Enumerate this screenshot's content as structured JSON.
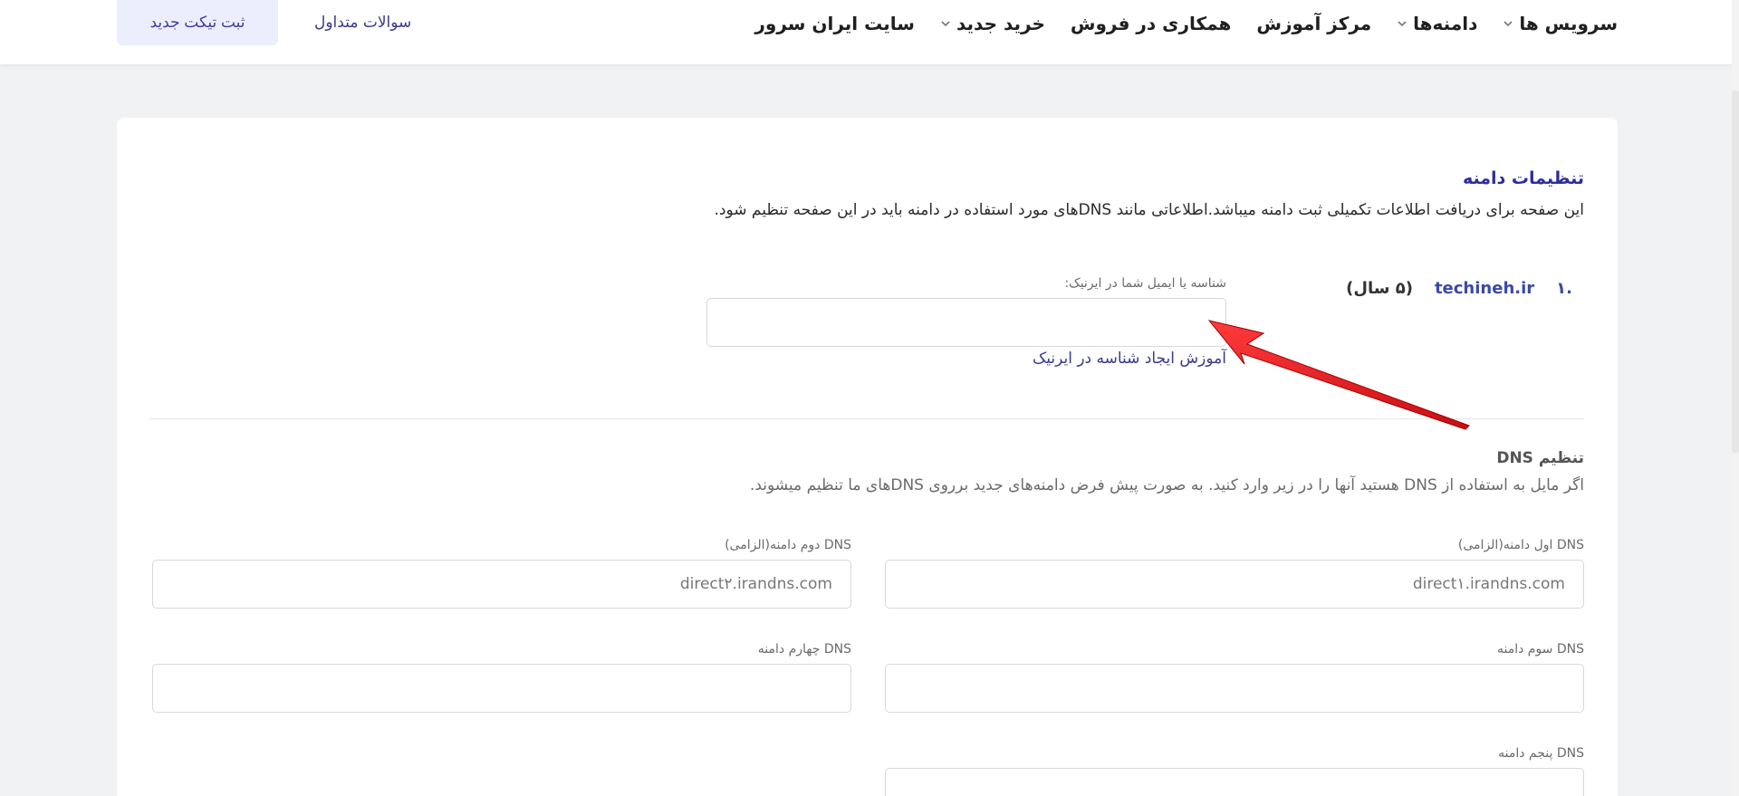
{
  "nav": {
    "items": [
      {
        "label": "سرویس ها",
        "has_dropdown": true
      },
      {
        "label": "دامنه‌ها",
        "has_dropdown": true
      },
      {
        "label": "مرکز آموزش",
        "has_dropdown": false
      },
      {
        "label": "همکاری در فروش",
        "has_dropdown": false
      },
      {
        "label": "خرید جدید",
        "has_dropdown": true
      },
      {
        "label": "سایت ایران سرور",
        "has_dropdown": false
      }
    ],
    "faq_label": "سوالات متداول",
    "new_ticket_label": "ثبت تیکت جدید"
  },
  "settings": {
    "title": "تنظیمات دامنه",
    "description": "این صفحه برای دریافت اطلاعات تکمیلی ثبت دامنه میباشد.اطلاعاتی مانند DNSهای مورد استفاده در دامنه باید در این صفحه تنظیم شود."
  },
  "domain": {
    "index": ".۱",
    "name": "techineh.ir",
    "years": "(۵ سال)",
    "nic_label": "شناسه یا ایمیل شما در ایرنیک:",
    "nic_value": "",
    "nic_help": "آموزش ایجاد شناسه در ایرنیک"
  },
  "dns": {
    "title": "تنظیم DNS",
    "description": "اگر مایل به استفاده از DNS هستید آنها را در زیر وارد کنید. به صورت پیش فرض دامنه‌های جدید برروی DNSهای ما تنظیم میشوند.",
    "fields": [
      {
        "label": "DNS اول دامنه(الزامی)",
        "value": "direct۱.irandns.com"
      },
      {
        "label": "DNS دوم دامنه(الزامی)",
        "value": "direct۲.irandns.com"
      },
      {
        "label": "DNS سوم دامنه",
        "value": ""
      },
      {
        "label": "DNS چهارم دامنه",
        "value": ""
      },
      {
        "label": "DNS پنجم دامنه",
        "value": ""
      }
    ]
  },
  "colors": {
    "accent": "#2d2e9c",
    "annotation_arrow": "#e8141b",
    "ticket_button_bg": "#eceefd"
  }
}
